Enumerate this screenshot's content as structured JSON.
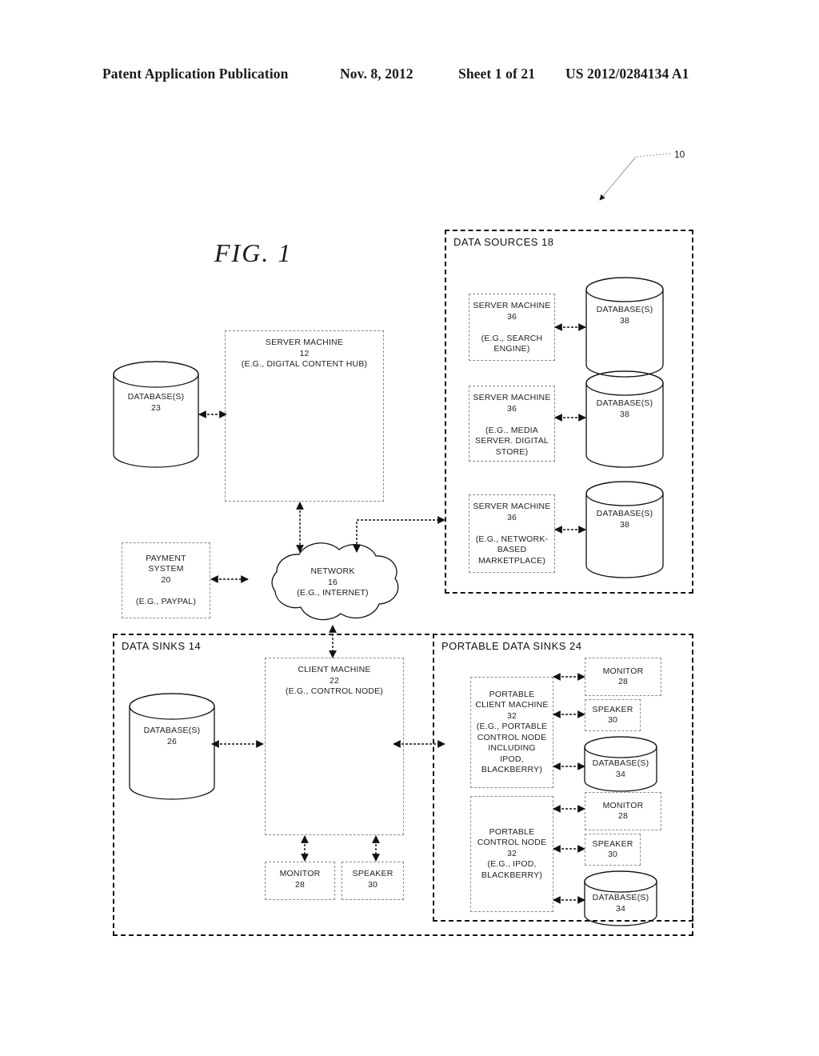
{
  "header": {
    "left": "Patent Application Publication",
    "date": "Nov. 8, 2012",
    "sheet": "Sheet 1 of 21",
    "number": "US 2012/0284134 A1"
  },
  "figure": {
    "label": "FIG. 1",
    "ref_numeral": "10"
  },
  "groups": {
    "data_sources": "DATA SOURCES 18",
    "data_sinks": "DATA SINKS 14",
    "portable_data_sinks": "PORTABLE DATA SINKS 24"
  },
  "nodes": {
    "database_23": "DATABASE(S)\n23",
    "server_machine_12": "SERVER MACHINE\n12\n(E.G., DIGITAL CONTENT HUB)",
    "payment_system_20": "PAYMENT\nSYSTEM\n20\n\n(E.G., PAYPAL)",
    "network_16": "NETWORK\n16\n(E.G., INTERNET)",
    "server_machine_36_search": "SERVER MACHINE\n36\n\n(E.G., SEARCH\nENGINE)",
    "server_machine_36_media": "SERVER MACHINE\n36\n\n(E.G., MEDIA\nSERVER. DIGITAL\nSTORE)",
    "server_machine_36_marketplace": "SERVER MACHINE\n36\n\n(E.G., NETWORK-\nBASED\nMARKETPLACE)",
    "database_38_a": "DATABASE(S)\n38",
    "database_38_b": "DATABASE(S)\n38",
    "database_38_c": "DATABASE(S)\n38",
    "database_26": "DATABASE(S)\n26",
    "client_machine_22": "CLIENT MACHINE\n22\n(E.G., CONTROL NODE)",
    "monitor_28_client": "MONITOR\n28",
    "speaker_30_client": "SPEAKER\n30",
    "portable_client_machine_32": "PORTABLE\nCLIENT MACHINE\n32\n(E.G., PORTABLE\nCONTROL NODE\nINCLUDING\nIPOD,\nBLACKBERRY)",
    "monitor_28_p1": "MONITOR\n28",
    "speaker_30_p1": "SPEAKER\n30",
    "database_34_p1": "DATABASE(S)\n34",
    "portable_control_node_32": "PORTABLE\nCONTROL NODE\n32\n(E.G., IPOD,\nBLACKBERRY)",
    "monitor_28_p2": "MONITOR\n28",
    "speaker_30_p2": "SPEAKER\n30",
    "database_34_p2": "DATABASE(S)\n34"
  },
  "colors": {
    "ink": "#1a1a1a",
    "dash_light": "#8d8d8d",
    "dash_dark": "#111111",
    "page": "#ffffff"
  }
}
